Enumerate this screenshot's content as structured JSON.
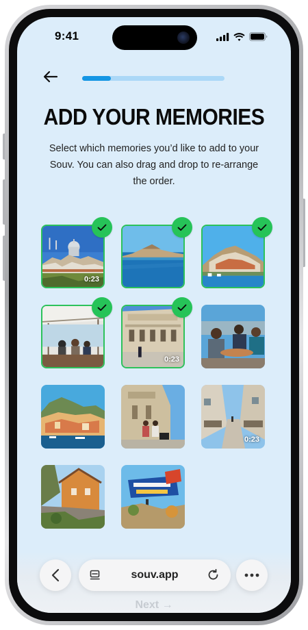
{
  "status_bar": {
    "time": "9:41"
  },
  "header": {
    "back_icon": "arrow-left-icon",
    "progress_fraction": 0.2
  },
  "content": {
    "title": "ADD YOUR MEMORIES",
    "subtitle": "Select which memories you’d like to add to your Souv. You can also drag and drop to re-arrange the order."
  },
  "memories": [
    {
      "subject": "old-town-church-dome",
      "selected": true,
      "duration": "0:23"
    },
    {
      "subject": "island-town-across-sea",
      "selected": true,
      "duration": ""
    },
    {
      "subject": "hillside-harbor-town",
      "selected": true,
      "duration": ""
    },
    {
      "subject": "group-on-boat-deck",
      "selected": true,
      "duration": ""
    },
    {
      "subject": "town-hall-loggia-square",
      "selected": true,
      "duration": "0:23"
    },
    {
      "subject": "friends-at-cafe-table",
      "selected": false,
      "duration": ""
    },
    {
      "subject": "harbor-town-at-sunset",
      "selected": false,
      "duration": ""
    },
    {
      "subject": "family-by-cathedral",
      "selected": false,
      "duration": ""
    },
    {
      "subject": "stone-street-cafes",
      "selected": false,
      "duration": "0:23"
    },
    {
      "subject": "stone-house-garden",
      "selected": false,
      "duration": ""
    },
    {
      "subject": "welcome-sign",
      "selected": false,
      "duration": ""
    }
  ],
  "browser": {
    "url": "souv.app",
    "hidden_button_label": "Next →",
    "icons": [
      "chevron-left-icon",
      "reader-icon",
      "reload-icon",
      "more-icon"
    ]
  },
  "colors": {
    "background": "#dcedfa",
    "accent": "#1596e4",
    "selected": "#26c358"
  }
}
